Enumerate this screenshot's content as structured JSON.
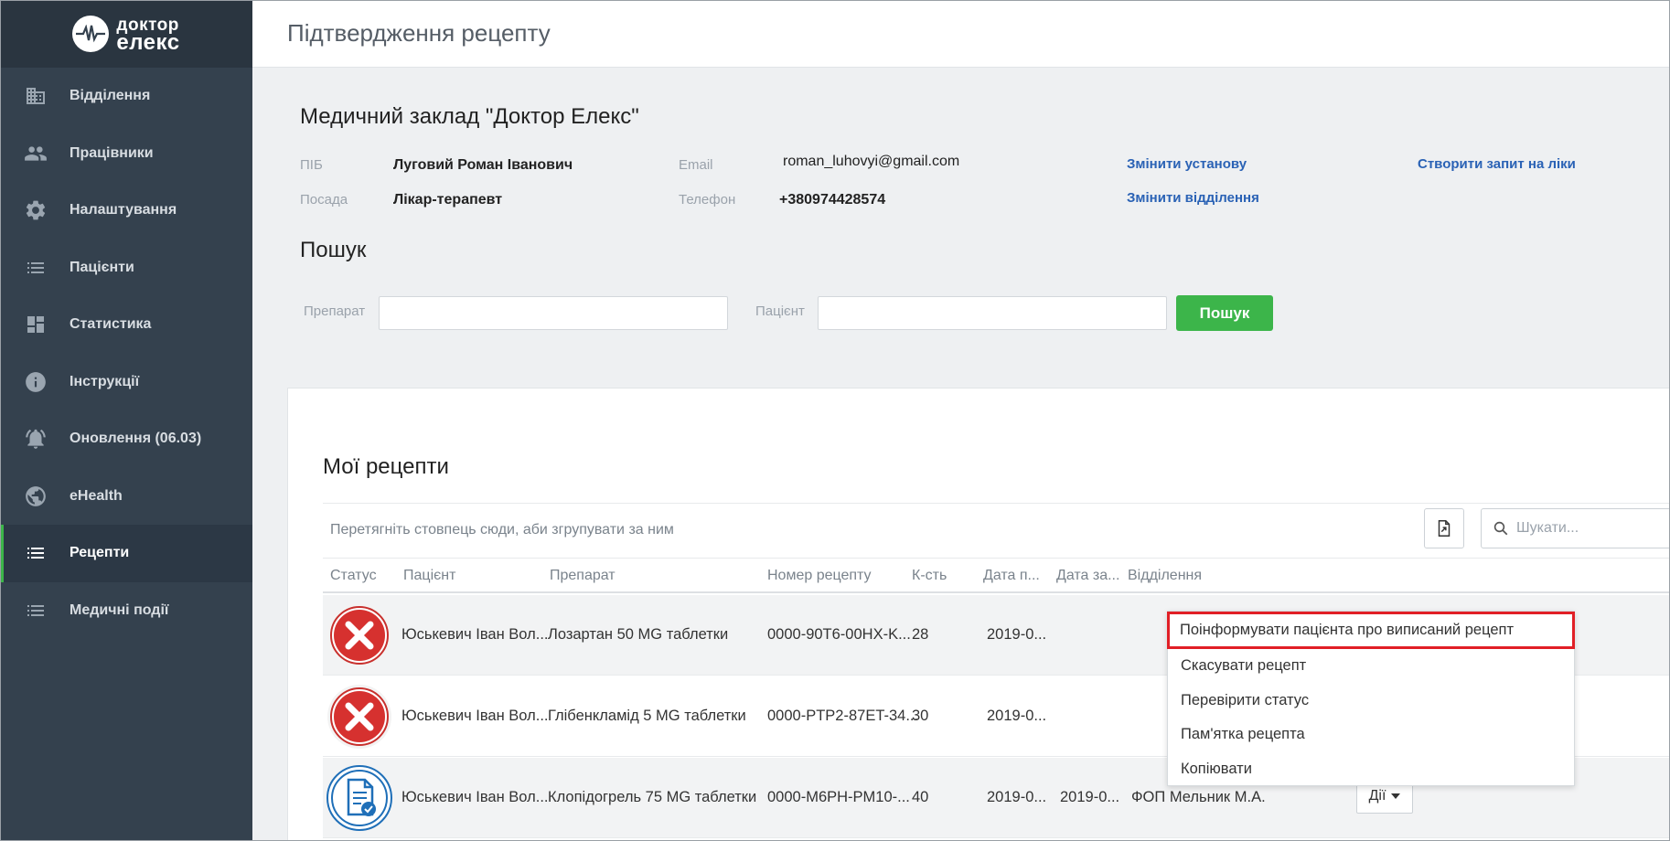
{
  "logo": {
    "line1": "доктор",
    "line2": "елекс"
  },
  "sidebar": {
    "items": [
      {
        "label": "Відділення",
        "icon": "building-icon",
        "active": false
      },
      {
        "label": "Працівники",
        "icon": "people-icon",
        "active": false
      },
      {
        "label": "Налаштування",
        "icon": "gear-icon",
        "active": false
      },
      {
        "label": "Пацієнти",
        "icon": "list-icon",
        "active": false
      },
      {
        "label": "Статистика",
        "icon": "dashboard-icon",
        "active": false
      },
      {
        "label": "Інструкції",
        "icon": "info-icon",
        "active": false
      },
      {
        "label": "Оновлення (06.03)",
        "icon": "bell-icon",
        "active": false
      },
      {
        "label": "eHealth",
        "icon": "globe-icon",
        "active": false
      },
      {
        "label": "Рецепти",
        "icon": "list-icon",
        "active": true
      },
      {
        "label": "Медичні події",
        "icon": "list-icon",
        "active": false
      }
    ]
  },
  "header": {
    "title": "Підтвердження рецепту"
  },
  "clinic": {
    "name": "Медичний заклад \"Доктор Елекс\"",
    "pib_label": "ПІБ",
    "pib_value": "Луговий Роман Іванович",
    "position_label": "Посада",
    "position_value": "Лікар-терапевт",
    "email_label": "Email",
    "email_value": "roman_luhovyi@gmail.com",
    "phone_label": "Телефон",
    "phone_value": "+380974428574",
    "change_institution": "Змінити установу",
    "change_department": "Змінити відділення",
    "create_request": "Створити запит на ліки"
  },
  "search": {
    "title": "Пошук",
    "drug_label": "Препарат",
    "drug_value": "",
    "patient_label": "Пацієнт",
    "patient_value": "",
    "button": "Пошук"
  },
  "recipes": {
    "title": "Мої рецепти",
    "group_hint": "Перетягніть стовпець сюди, аби згрупувати за ним",
    "search_placeholder": "Шукати...",
    "columns": [
      "Статус",
      "Пацієнт",
      "Препарат",
      "Номер рецепту",
      "К-сть",
      "Дата п...",
      "Дата за...",
      "Відділення"
    ],
    "rows": [
      {
        "status": "cancelled",
        "status_icon": "cancel-icon",
        "patient": "Юськевич Іван Вол...",
        "drug": "Лозартан 50 MG таблетки",
        "number": "0000-90T6-00HX-K...",
        "qty": "28",
        "date_p": "2019-0...",
        "date_z": "",
        "department": ""
      },
      {
        "status": "cancelled",
        "status_icon": "cancel-icon",
        "patient": "Юськевич Іван Вол...",
        "drug": "Глібенкламід 5 MG таблетки",
        "number": "0000-PTP2-87ET-34...",
        "qty": "30",
        "date_p": "2019-0...",
        "date_z": "",
        "department": ""
      },
      {
        "status": "confirmed",
        "status_icon": "document-check-icon",
        "patient": "Юськевич Іван Вол...",
        "drug": "Клопідогрель 75 MG таблетки",
        "number": "0000-M6PH-PM10-...",
        "qty": "40",
        "date_p": "2019-0...",
        "date_z": "2019-0...",
        "department": "ФОП Мельник М.А.",
        "actions": "Дії"
      }
    ]
  },
  "menu": {
    "items": [
      {
        "label": "Поінформувати пацієнта про виписаний рецепт",
        "highlight": true
      },
      {
        "label": "Скасувати рецепт",
        "highlight": false
      },
      {
        "label": "Перевірити статус",
        "highlight": false
      },
      {
        "label": "Пам'ятка рецепта",
        "highlight": false
      },
      {
        "label": "Копіювати",
        "highlight": false
      }
    ]
  },
  "colors": {
    "sidebar_bg": "#34414e",
    "accent_green": "#3cb54a",
    "link_blue": "#2a62b5",
    "cancel_red": "#d6312f",
    "confirm_blue": "#1f6fb8",
    "highlight_red": "#e11f26"
  }
}
